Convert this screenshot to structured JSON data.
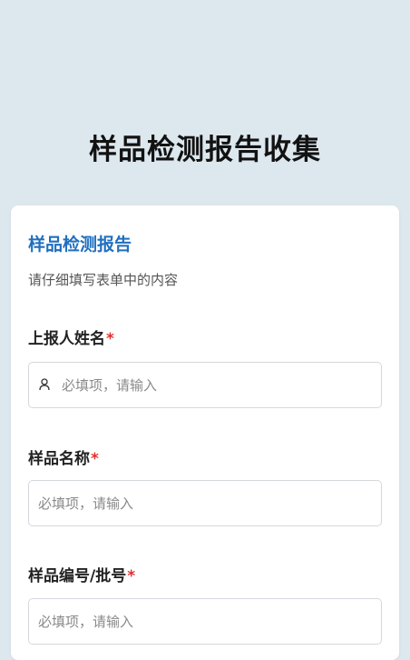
{
  "page": {
    "title": "样品检测报告收集"
  },
  "form": {
    "title": "样品检测报告",
    "description": "请仔细填写表单中的内容",
    "required_mark": "*",
    "fields": [
      {
        "label": "上报人姓名",
        "placeholder": "必填项，请输入",
        "icon": "user-icon",
        "value": ""
      },
      {
        "label": "样品名称",
        "placeholder": "必填项，请输入",
        "value": ""
      },
      {
        "label": "样品编号/批号",
        "placeholder": "必填项，请输入",
        "value": ""
      }
    ]
  },
  "colors": {
    "background": "#dde7ee",
    "card": "#ffffff",
    "accent": "#1f6fbf",
    "required": "#e03030"
  }
}
